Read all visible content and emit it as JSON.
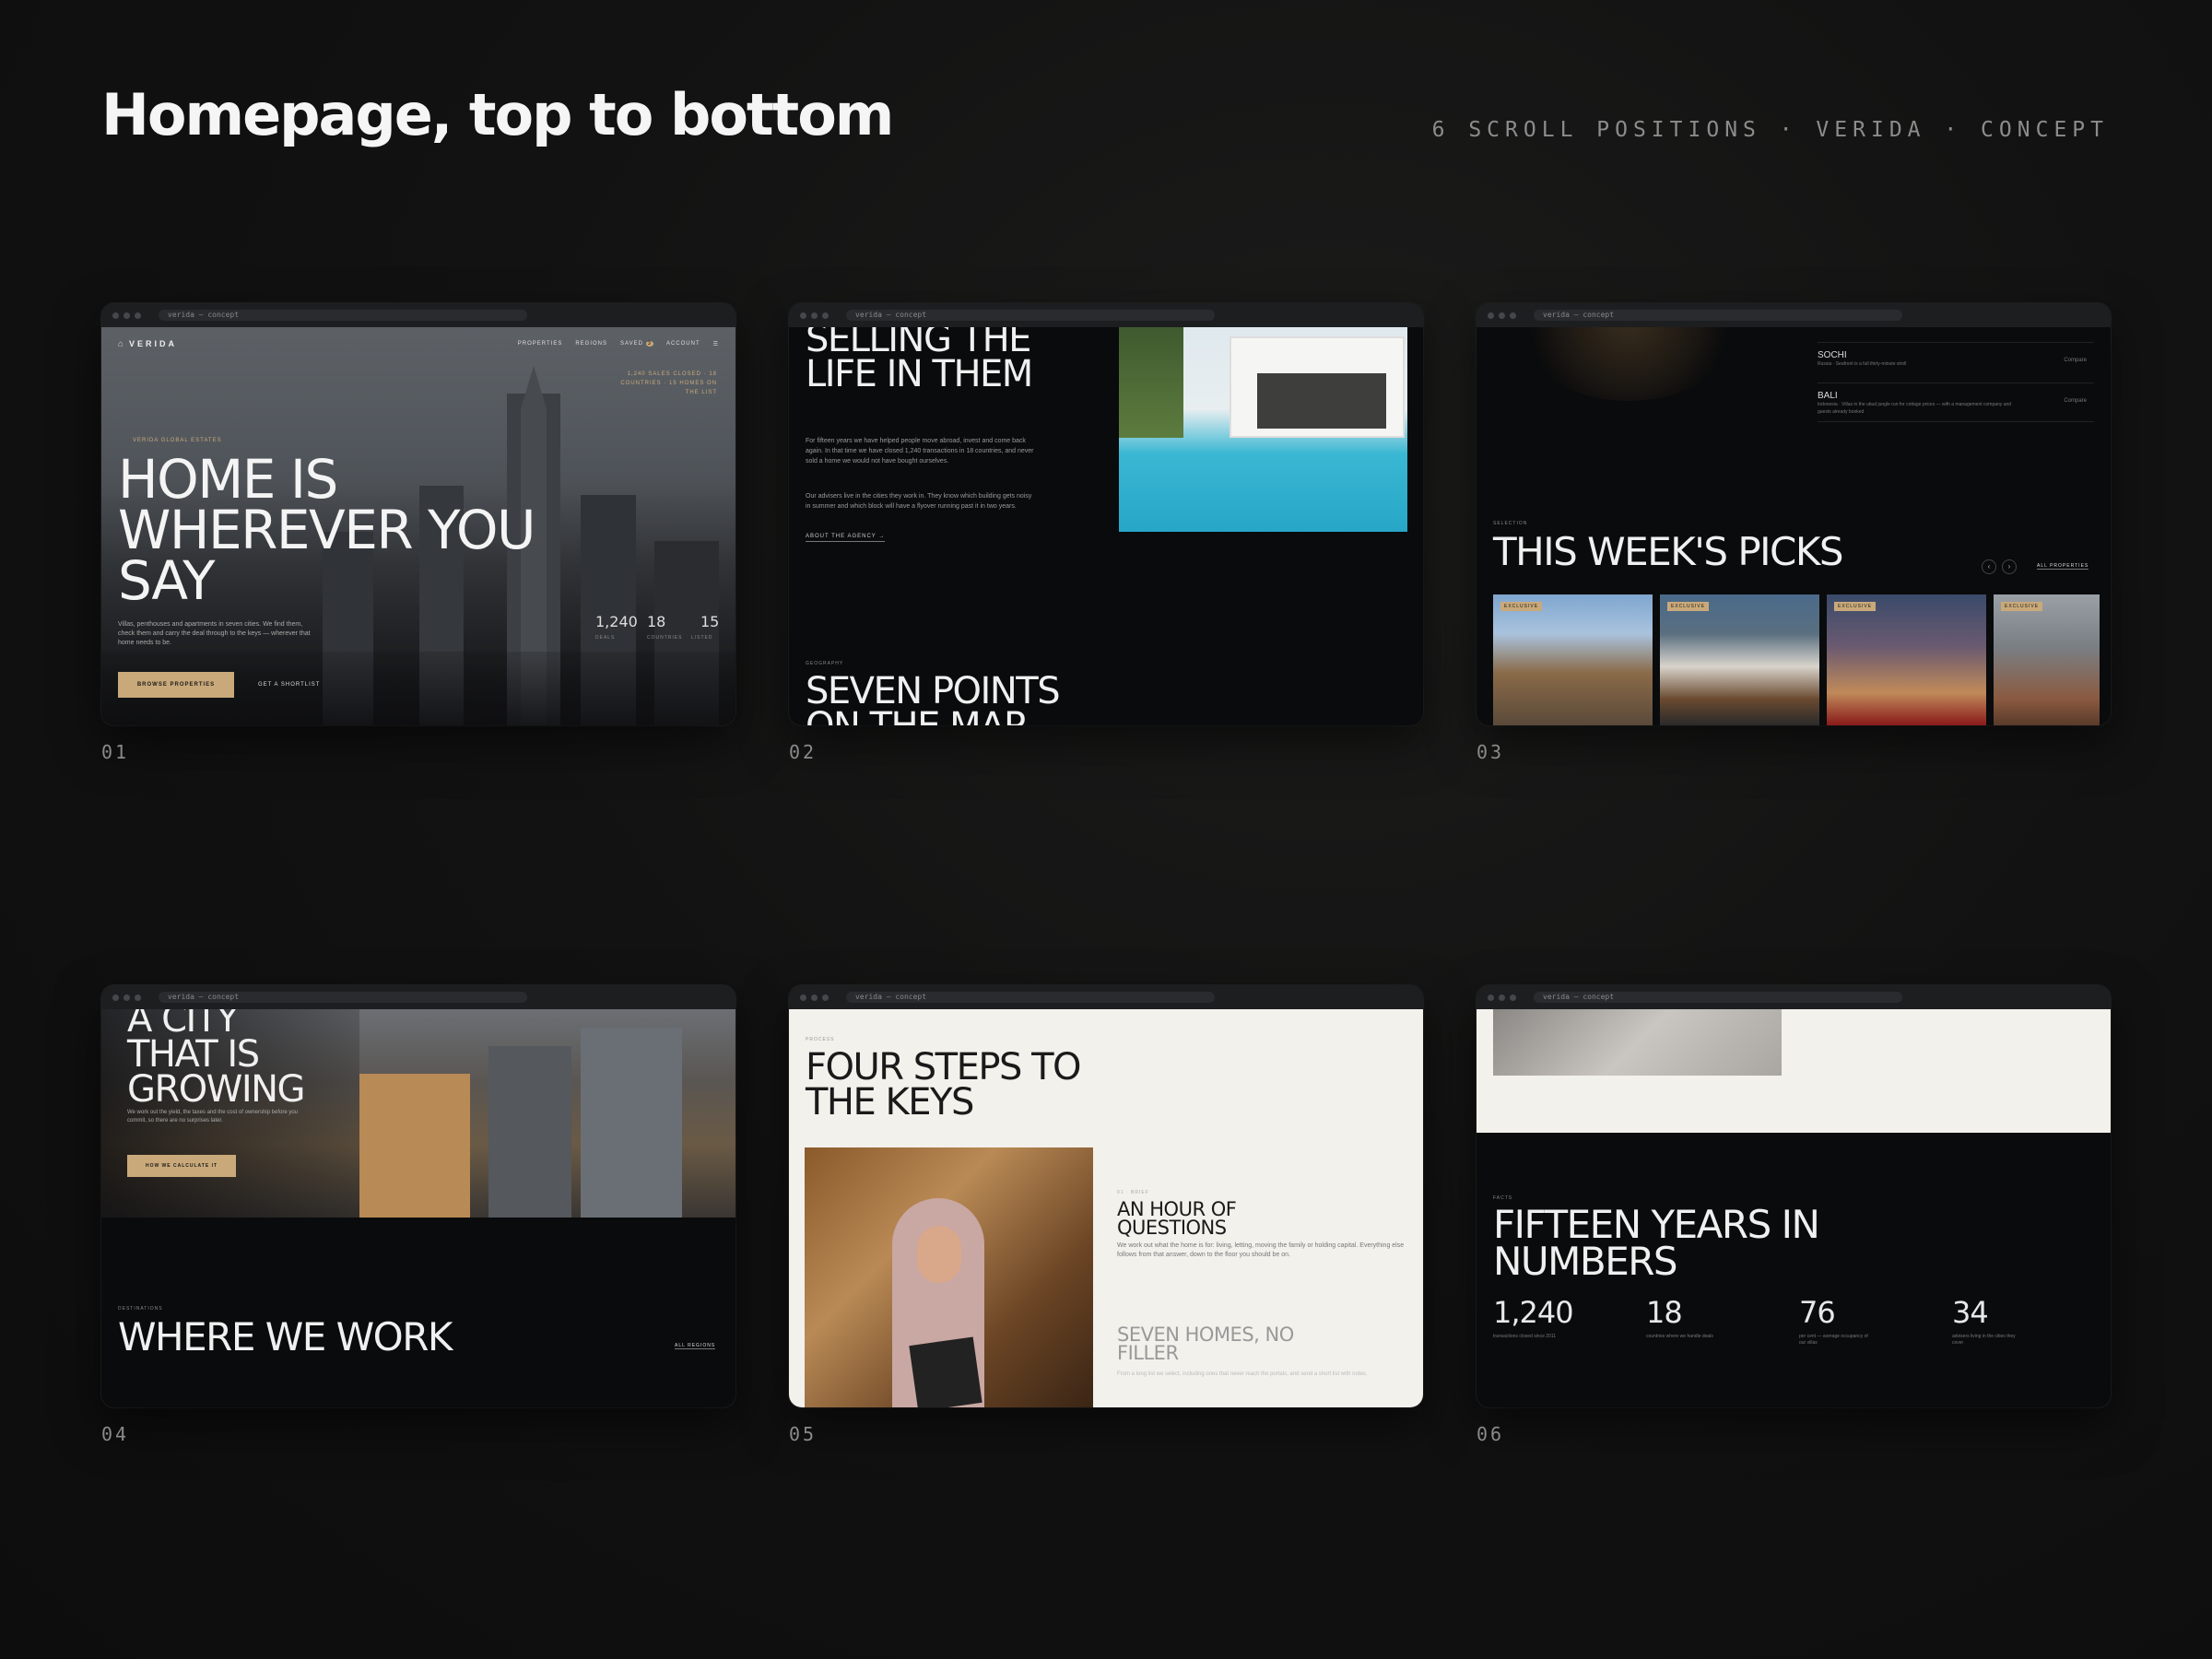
{
  "header": {
    "title": "Homepage, top to bottom",
    "meta": "6 SCROLL POSITIONS · VERIDA · CONCEPT"
  },
  "browser": {
    "url": "verida — concept"
  },
  "frames": [
    {
      "label": "01",
      "logo": "VERIDA",
      "nav": [
        "PROPERTIES",
        "REGIONS",
        "SAVED",
        "ACCOUNT"
      ],
      "saved_count": "3",
      "eyebrow": "VERIDA GLOBAL ESTATES",
      "headline": "HOME IS WHEREVER YOU SAY",
      "tagline": "1,240 SALES CLOSED · 18 COUNTRIES · 15 HOMES ON THE LIST",
      "body": "Villas, penthouses and apartments in seven cities. We find them, check them and carry the deal through to the keys — wherever that home needs to be.",
      "primary_cta": "BROWSE PROPERTIES",
      "secondary_cta": "GET A SHORTLIST",
      "stats": [
        "1,240",
        "18",
        "15"
      ],
      "stat_labels": [
        "DEALS",
        "COUNTRIES",
        "LISTED"
      ]
    },
    {
      "label": "02",
      "headline": "SELLING THE LIFE IN THEM",
      "body1": "For fifteen years we have helped people move abroad, invest and come back again. In that time we have closed 1,240 transactions in 18 countries, and never sold a home we would not have bought ourselves.",
      "body2": "Our advisers live in the cities they work in. They know which building gets noisy in summer and which block will have a flyover running past it in two years.",
      "link": "ABOUT THE AGENCY →",
      "eyebrow": "GEOGRAPHY",
      "next_headline": "SEVEN POINTS ON THE MAP"
    },
    {
      "label": "03",
      "regions": [
        {
          "name": "SOCHI",
          "desc": "Russia · Seafront is a full thirty-minute stroll",
          "link": "Compare"
        },
        {
          "name": "BALI",
          "desc": "Indonesia · Villas in the ubud jungle run for cottage prices — with a management company and guests already booked",
          "link": "Compare"
        }
      ],
      "eyebrow": "SELECTION",
      "headline": "THIS WEEK'S PICKS",
      "all_link": "ALL PROPERTIES",
      "badges": [
        "EXCLUSIVE",
        "EXCLUSIVE",
        "EXCLUSIVE",
        "EXCLUSIVE"
      ]
    },
    {
      "label": "04",
      "headline": "A CITY THAT IS GROWING",
      "body": "We work out the yield, the taxes and the cost of ownership before you commit, so there are no surprises later.",
      "cta": "HOW WE CALCULATE IT",
      "eyebrow": "DESTINATIONS",
      "next_headline": "WHERE WE WORK",
      "all_link": "ALL REGIONS"
    },
    {
      "label": "05",
      "eyebrow": "PROCESS",
      "headline": "FOUR STEPS TO THE KEYS",
      "step_tag": "01 · BRIEF",
      "step_title": "AN HOUR OF QUESTIONS",
      "step_body": "We work out what the home is for: living, letting, moving the family or holding capital. Everything else follows from that answer, down to the floor you should be on.",
      "next_title": "SEVEN HOMES, NO FILLER",
      "next_body": "From a long list we select, including ones that never reach the portals, and send a short list with notes."
    },
    {
      "label": "06",
      "eyebrow": "FACTS",
      "headline": "FIFTEEN YEARS IN NUMBERS",
      "stats": [
        {
          "value": "1,240",
          "label": "transactions closed since 2011"
        },
        {
          "value": "18",
          "label": "countries where we handle deals"
        },
        {
          "value": "76",
          "label": "per cent — average occupancy of our villas"
        },
        {
          "value": "34",
          "label": "advisers living in the cities they cover"
        }
      ]
    }
  ]
}
